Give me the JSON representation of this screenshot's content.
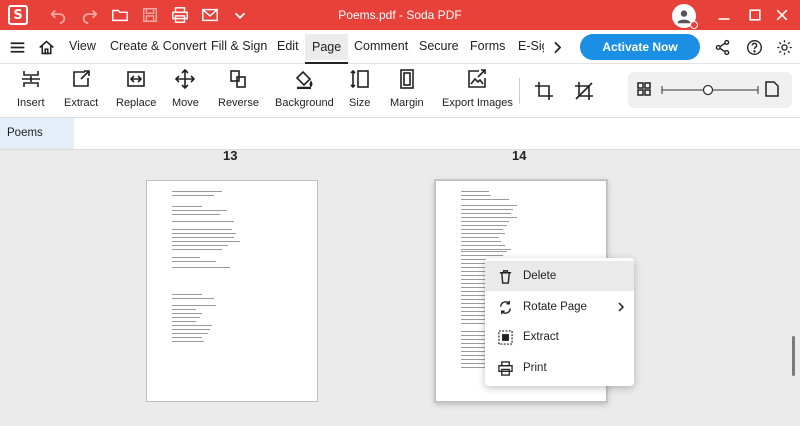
{
  "titlebar": {
    "app_logo_letter": "S",
    "title": "Poems.pdf - Soda PDF",
    "icons": [
      "undo-icon",
      "redo-icon",
      "open-folder-icon",
      "save-icon",
      "print-icon",
      "email-icon",
      "chevron-down-icon",
      "user-avatar-icon",
      "minimize-icon",
      "maximize-icon",
      "close-icon"
    ],
    "accent_color": "#e8413a"
  },
  "menubar": {
    "tabs": [
      "View",
      "Create & Convert",
      "Fill & Sign",
      "Edit",
      "Page",
      "Comment",
      "Secure",
      "Forms",
      "E-Sig"
    ],
    "active_tab": "Page",
    "activate_label": "Activate Now",
    "activate_color": "#1a8fe3",
    "icons": [
      "hamburger-menu-icon",
      "home-icon",
      "chevron-right-icon",
      "share-icon",
      "help-icon",
      "settings-gear-icon"
    ]
  },
  "toolbar": {
    "tools": [
      {
        "label": "Insert",
        "icon": "insert-pages-icon"
      },
      {
        "label": "Extract",
        "icon": "extract-icon"
      },
      {
        "label": "Replace",
        "icon": "replace-icon"
      },
      {
        "label": "Move",
        "icon": "move-icon"
      },
      {
        "label": "Reverse",
        "icon": "reverse-icon"
      },
      {
        "label": "Background",
        "icon": "background-paint-icon"
      },
      {
        "label": "Size",
        "icon": "size-icon"
      },
      {
        "label": "Margin",
        "icon": "margin-icon"
      },
      {
        "label": "Export Images",
        "icon": "export-images-icon"
      }
    ],
    "extra_icons": [
      "crop-icon",
      "crop-remove-icon",
      "grid-view-icon",
      "zoom-slider",
      "single-page-icon"
    ]
  },
  "document": {
    "tab_label": "Poems"
  },
  "pages": [
    {
      "number": "13"
    },
    {
      "number": "14"
    }
  ],
  "context_menu": {
    "items": [
      {
        "label": "Delete",
        "icon": "trash-icon"
      },
      {
        "label": "Rotate Page",
        "icon": "rotate-icon"
      },
      {
        "label": "Extract",
        "icon": "extract-page-icon"
      },
      {
        "label": "Print",
        "icon": "print-icon"
      }
    ]
  }
}
